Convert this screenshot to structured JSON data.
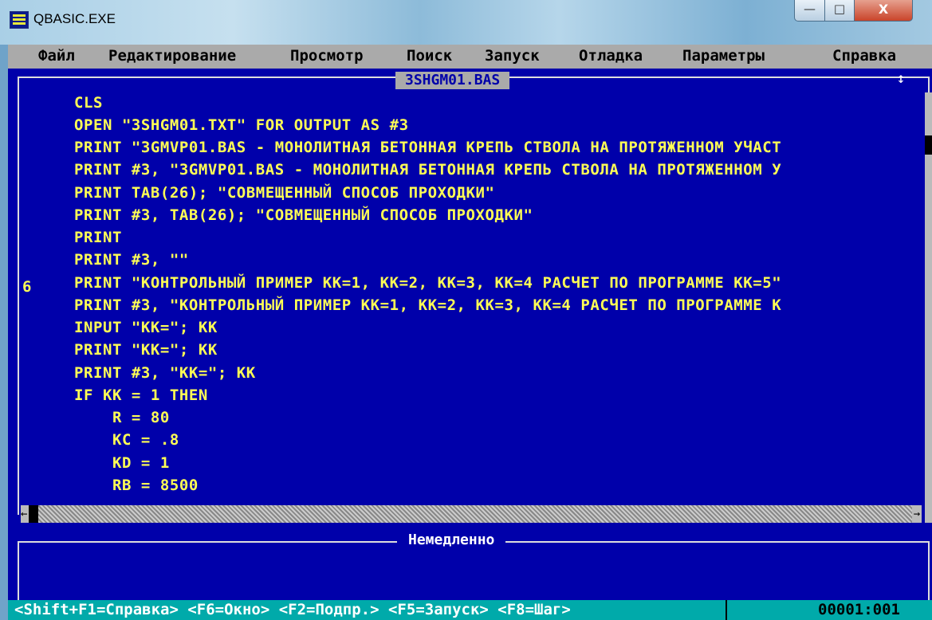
{
  "window": {
    "title": "QBASIC.EXE",
    "min_label": "—",
    "max_label": "□",
    "close_label": "X"
  },
  "menu": [
    "Файл",
    "Редактирование",
    "Просмотр",
    "Поиск",
    "Запуск",
    "Отладка",
    "Параметры",
    "Справка"
  ],
  "editor": {
    "file_name": "3SHGM01.BAS",
    "scroll_indicator": "↕",
    "line_marker": "6",
    "lines": [
      "CLS",
      "OPEN \"3SHGM01.TXT\" FOR OUTPUT AS #3",
      "PRINT \"3GMVP01.BAS - МОНОЛИТНАЯ БЕТОННАЯ КРЕПЬ СТВОЛА НА ПРОТЯЖЕННОМ УЧАСТ",
      "PRINT #3, \"3GMVP01.BAS - МОНОЛИТНАЯ БЕТОННАЯ КРЕПЬ СТВОЛА НА ПРОТЯЖЕННОМ У",
      "PRINT TAB(26); \"СОВМЕЩЕННЫЙ СПОСОБ ПРОХОДКИ\"",
      "PRINT #3, TAB(26); \"СОВМЕЩЕННЫЙ СПОСОБ ПРОХОДКИ\"",
      "PRINT",
      "PRINT #3, \"\"",
      "PRINT \"КОНТРОЛЬНЫЙ ПРИМЕР KK=1, KK=2, KK=3, KK=4 РАСЧЕТ ПО ПРОГРАММЕ KK=5\"",
      "PRINT #3, \"КОНТРОЛЬНЫЙ ПРИМЕР KK=1, KK=2, KK=3, KK=4 РАСЧЕТ ПО ПРОГРАММЕ K",
      "INPUT \"KK=\"; KK",
      "PRINT \"KK=\"; KK",
      "PRINT #3, \"KK=\"; KK",
      "IF KK = 1 THEN",
      "    R = 80",
      "    KC = .8",
      "    KD = 1",
      "    RB = 8500"
    ]
  },
  "immediate": {
    "title": "Немедленно"
  },
  "status": {
    "hints": "<Shift+F1=Справка> <F6=Окно> <F2=Подпр.> <F5=Запуск> <F8=Шаг>",
    "position": "00001:001"
  },
  "colors": {
    "background": "#0000aa",
    "code_text": "#ffff55",
    "menu_bg": "#aaaaaa",
    "status_bg": "#00aaaa"
  }
}
